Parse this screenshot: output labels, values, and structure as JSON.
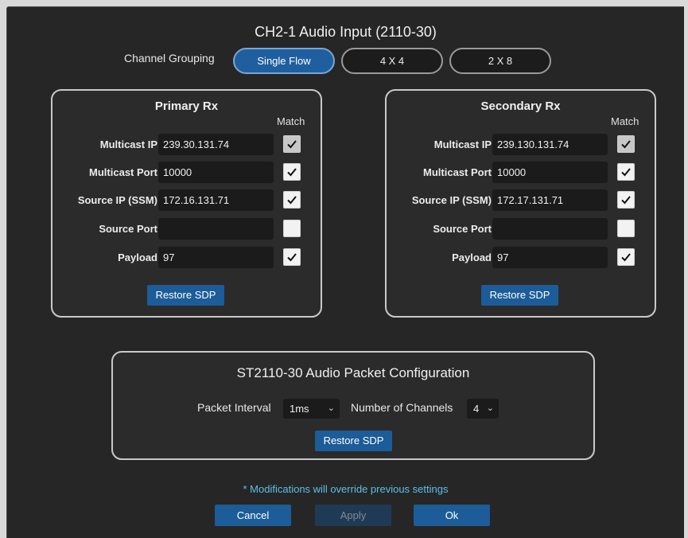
{
  "dialog": {
    "title": "CH2-1 Audio Input (2110-30)",
    "channel_grouping": {
      "label": "Channel Grouping",
      "options": [
        "Single Flow",
        "4 X 4",
        "2 X 8"
      ],
      "selected": "Single Flow"
    }
  },
  "match_label": "Match",
  "row_labels": {
    "multicast_ip": "Multicast IP",
    "multicast_port": "Multicast Port",
    "source_ip": "Source IP (SSM)",
    "source_port": "Source Port",
    "payload": "Payload"
  },
  "primary": {
    "title": "Primary Rx",
    "multicast_ip": "239.30.131.74",
    "multicast_port": "10000",
    "source_ip": "172.16.131.71",
    "source_port": "",
    "payload": "97",
    "match": {
      "multicast_ip": true,
      "multicast_port": true,
      "source_ip": true,
      "source_port": false,
      "payload": true
    },
    "restore_label": "Restore SDP"
  },
  "secondary": {
    "title": "Secondary Rx",
    "multicast_ip": "239.130.131.74",
    "multicast_port": "10000",
    "source_ip": "172.17.131.71",
    "source_port": "",
    "payload": "97",
    "match": {
      "multicast_ip": true,
      "multicast_port": true,
      "source_ip": true,
      "source_port": false,
      "payload": true
    },
    "restore_label": "Restore SDP"
  },
  "packet_config": {
    "title": "ST2110-30 Audio Packet Configuration",
    "packet_interval_label": "Packet Interval",
    "packet_interval_value": "1ms",
    "channels_label": "Number of Channels",
    "channels_value": "4",
    "restore_label": "Restore SDP"
  },
  "note": "* Modifications will override previous settings",
  "footer": {
    "cancel_label": "Cancel",
    "apply_label": "Apply",
    "ok_label": "Ok"
  },
  "colors": {
    "accent": "#1c5c98",
    "note": "#5cc0e8",
    "background": "#262626"
  }
}
